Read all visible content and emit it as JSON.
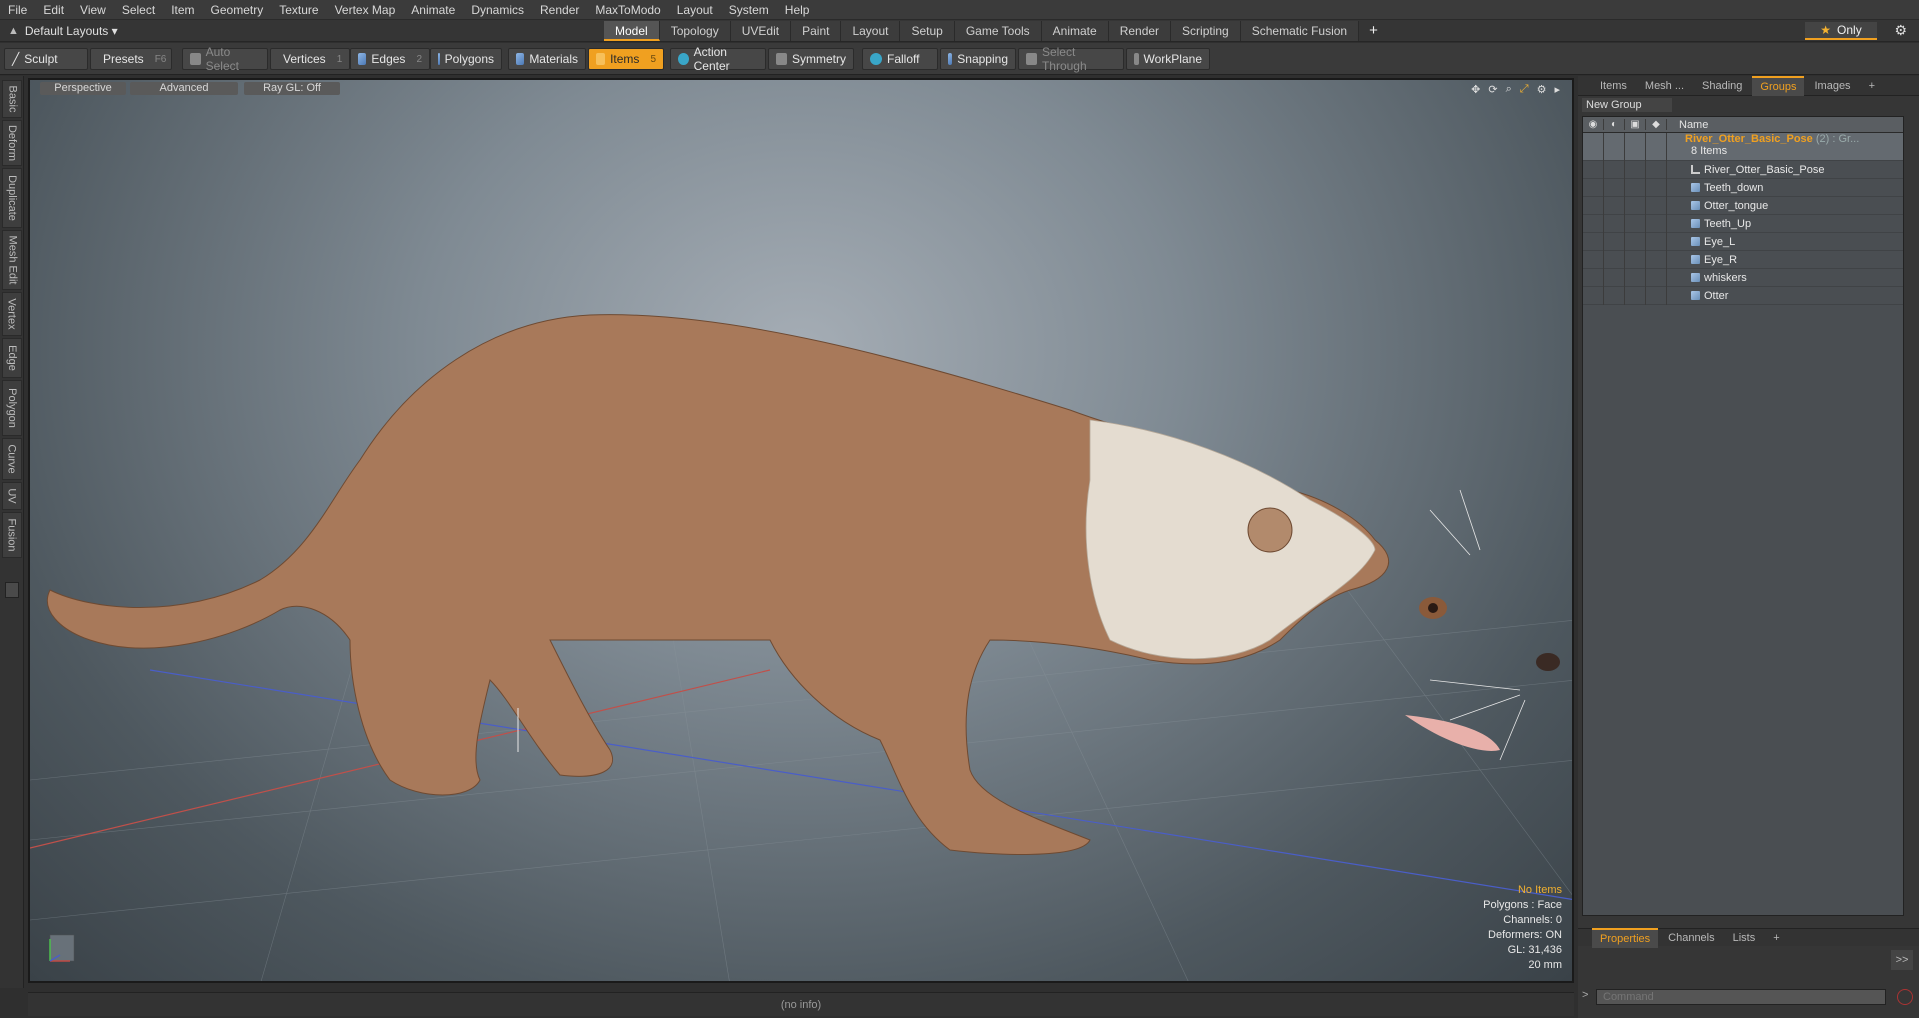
{
  "menu": [
    "File",
    "Edit",
    "View",
    "Select",
    "Item",
    "Geometry",
    "Texture",
    "Vertex Map",
    "Animate",
    "Dynamics",
    "Render",
    "MaxToModo",
    "Layout",
    "System",
    "Help"
  ],
  "layout": {
    "selector": "Default Layouts ▾",
    "tabs": [
      "Model",
      "Topology",
      "UVEdit",
      "Paint",
      "Layout",
      "Setup",
      "Game Tools",
      "Animate",
      "Render",
      "Scripting",
      "Schematic Fusion"
    ],
    "active_tab": "Model",
    "only_label": "Only"
  },
  "toolbar": {
    "sculpt": "Sculpt",
    "presets": "Presets",
    "presets_key": "F6",
    "auto_select": "Auto Select",
    "vertices": "Vertices",
    "vertices_key": "1",
    "edges": "Edges",
    "edges_key": "2",
    "polygons": "Polygons",
    "materials": "Materials",
    "items": "Items",
    "items_key": "5",
    "action_center": "Action Center",
    "symmetry": "Symmetry",
    "falloff": "Falloff",
    "snapping": "Snapping",
    "select_through": "Select Through",
    "workplane": "WorkPlane"
  },
  "left_tabs": [
    "Basic",
    "Deform",
    "Duplicate",
    "Mesh Edit",
    "Vertex",
    "Edge",
    "Polygon",
    "Curve",
    "UV",
    "Fusion"
  ],
  "viewport": {
    "view": "Perspective",
    "shading": "Advanced",
    "raygl": "Ray GL: Off",
    "info": {
      "selection": "No Items",
      "polygons": "Polygons : Face",
      "channels": "Channels: 0",
      "deformers": "Deformers: ON",
      "gl": "GL: 31,436",
      "scale": "20 mm"
    }
  },
  "status": "(no info)",
  "right_panel": {
    "tabs": [
      "Items",
      "Mesh ...",
      "Shading",
      "Groups",
      "Images"
    ],
    "active_tab": "Groups",
    "new_group": "New Group",
    "name_header": "Name",
    "group": {
      "name": "River_Otter_Basic_Pose",
      "suffix": "(2) : Gr...",
      "count": "8 Items"
    },
    "children": [
      "River_Otter_Basic_Pose",
      "Teeth_down",
      "Otter_tongue",
      "Teeth_Up",
      "Eye_L",
      "Eye_R",
      "whiskers",
      "Otter"
    ],
    "bottom_tabs": [
      "Properties",
      "Channels",
      "Lists"
    ],
    "command_placeholder": "Command"
  },
  "colors": {
    "accent": "#f0a020",
    "fur": "#a8795a",
    "belly": "#e4dcd0"
  }
}
